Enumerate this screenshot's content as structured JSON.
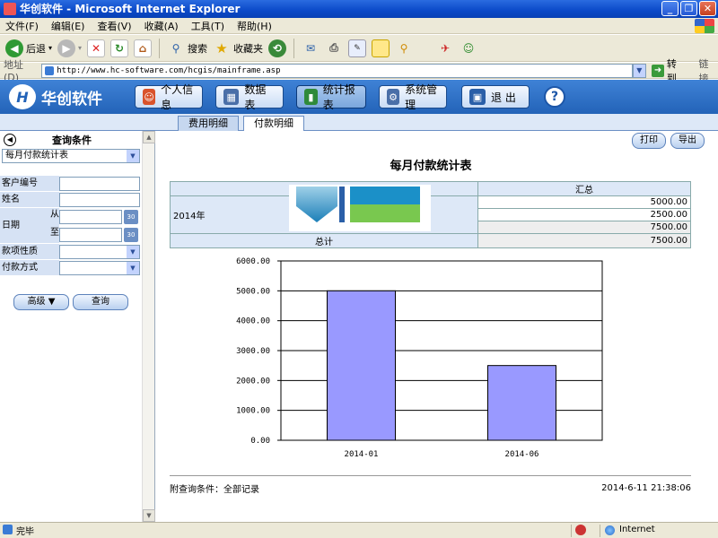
{
  "window": {
    "title": "华创软件 - Microsoft Internet Explorer",
    "min": "_",
    "max": "❐",
    "close": "✕"
  },
  "menu": [
    "文件(F)",
    "编辑(E)",
    "查看(V)",
    "收藏(A)",
    "工具(T)",
    "帮助(H)"
  ],
  "toolbar": {
    "back": "后退",
    "search": "搜索",
    "favorites": "收藏夹"
  },
  "address": {
    "label": "地址(D)",
    "url": "http://www.hc-software.com/hcgis/mainframe.asp",
    "go": "转到",
    "links": "链接"
  },
  "app": {
    "logo_text": "华创软件",
    "nav": [
      "个人信息",
      "数据表",
      "统计报表",
      "系统管理",
      "退  出"
    ],
    "help": "?"
  },
  "tabs": [
    "费用明细",
    "付款明细"
  ],
  "query": {
    "header": "查询条件",
    "report_select": "每月付款统计表",
    "fields": {
      "customer_no": "客户编号",
      "name": "姓名",
      "date": "日期",
      "from": "从",
      "to": "至",
      "payment_type": "款项性质",
      "payment_method": "付款方式"
    },
    "cal": "30",
    "advanced": "高级 ▼",
    "search": "查询"
  },
  "report": {
    "print": "打印",
    "export": "导出",
    "title": "每月付款统计表",
    "table": {
      "summary_header": "汇总",
      "year": "2014年",
      "values": [
        "5000.00",
        "2500.00",
        "7500.00"
      ],
      "total_label": "总计",
      "total_value": "7500.00"
    },
    "footer_condition": "附查询条件：全部记录",
    "footer_time": "2014-6-11 21:38:06"
  },
  "chart_data": {
    "type": "bar",
    "categories": [
      "2014-01",
      "2014-06"
    ],
    "values": [
      5000,
      2500
    ],
    "ylim": [
      0,
      6000
    ],
    "yticks": [
      "0.00",
      "1000.00",
      "2000.00",
      "3000.00",
      "4000.00",
      "5000.00",
      "6000.00"
    ],
    "grid": true,
    "colors": {
      "bar": "#9999ff",
      "edge": "#000000"
    }
  },
  "status": {
    "ready": "完毕",
    "zone": "Internet"
  }
}
